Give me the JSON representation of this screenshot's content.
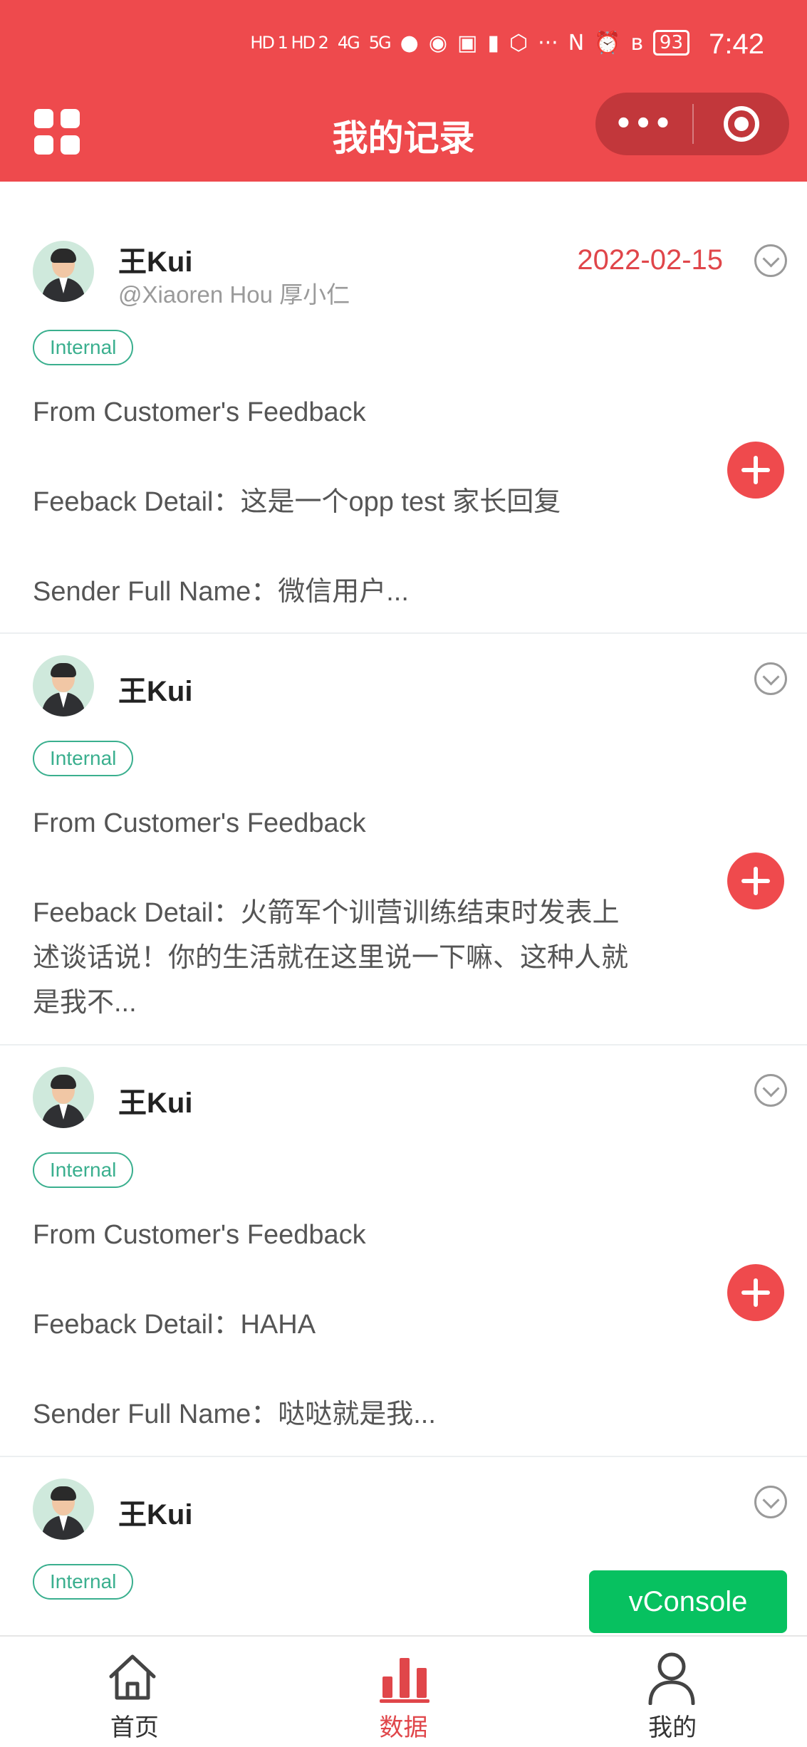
{
  "status_bar": {
    "network": "HD 1 HD 2",
    "signal_1": "4G",
    "signal_2": "5G",
    "extras": "···",
    "battery": "93",
    "time": "7:42"
  },
  "nav": {
    "title": "我的记录",
    "more_label": "•••"
  },
  "records": [
    {
      "name": "王Kui",
      "handle": "@Xiaoren Hou 厚小仁",
      "date": "2022-02-15",
      "tag": "Internal",
      "lines": [
        "From Customer's Feedback",
        "",
        "Feeback Detail：这是一个opp test 家长回复",
        "",
        "Sender Full Name：微信用户..."
      ]
    },
    {
      "name": "王Kui",
      "handle": "",
      "date": "",
      "tag": "Internal",
      "lines": [
        "From Customer's Feedback",
        "",
        "Feeback Detail：火箭军个训营训练结束时发表上",
        "述谈话说！你的生活就在这里说一下嘛、这种人就",
        "是我不..."
      ]
    },
    {
      "name": "王Kui",
      "handle": "",
      "date": "",
      "tag": "Internal",
      "lines": [
        "From Customer's Feedback",
        "",
        "Feeback Detail：HAHA",
        "",
        "Sender Full Name：哒哒就是我..."
      ]
    },
    {
      "name": "王Kui",
      "handle": "",
      "date": "",
      "tag": "Internal",
      "lines": []
    }
  ],
  "vconsole_label": "vConsole",
  "tabbar": {
    "home": "首页",
    "data": "数据",
    "mine": "我的"
  },
  "colors": {
    "header": "#ee4a4d",
    "accent": "#e0464a",
    "tag": "#3aaf8e",
    "vconsole": "#07c160"
  }
}
